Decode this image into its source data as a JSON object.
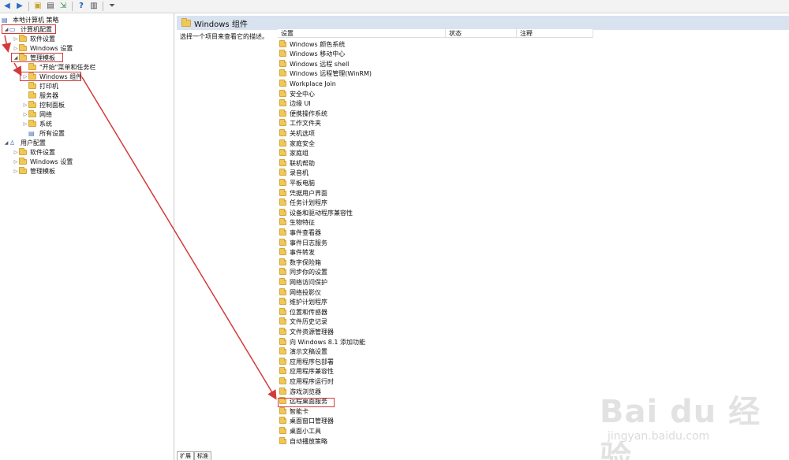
{
  "toolbar": {
    "buttons": [
      {
        "name": "back-icon",
        "glyph": "◀"
      },
      {
        "name": "forward-icon",
        "glyph": "▶"
      },
      {
        "name": "folder-up-icon",
        "glyph": "▣"
      },
      {
        "name": "properties-icon",
        "glyph": "▤"
      },
      {
        "name": "export-icon",
        "glyph": "⇲"
      },
      {
        "name": "help-icon",
        "glyph": "?"
      },
      {
        "name": "show-hide-icon",
        "glyph": "▥"
      },
      {
        "name": "filter-icon",
        "glyph": "⏷"
      }
    ]
  },
  "tree": {
    "root": "本地计算机 策略",
    "computer_config": "计算机配置",
    "software_settings": "软件设置",
    "windows_settings": "Windows 设置",
    "admin_templates": "管理模板",
    "start_menu": "\"开始\"菜单和任务栏",
    "windows_components": "Windows 组件",
    "printers": "打印机",
    "server": "服务器",
    "control_panel": "控制面板",
    "network": "网络",
    "system": "系统",
    "all_settings": "所有设置",
    "user_config": "用户配置",
    "user_software_settings": "软件设置",
    "user_windows_settings": "Windows 设置",
    "user_admin_templates": "管理模板"
  },
  "right": {
    "title": "Windows 组件",
    "description": "选择一个项目来查看它的描述。",
    "columns": [
      "设置",
      "状态",
      "注释"
    ],
    "items": [
      "Windows 颜色系统",
      "Windows 移动中心",
      "Windows 远程 shell",
      "Windows 远程管理(WinRM)",
      "Workplace Join",
      "安全中心",
      "边缘 UI",
      "便携操作系统",
      "工作文件夹",
      "关机选项",
      "家庭安全",
      "家庭组",
      "联机帮助",
      "录音机",
      "平板电脑",
      "凭据用户界面",
      "任务计划程序",
      "设备和驱动程序兼容性",
      "生物特征",
      "事件查看器",
      "事件日志服务",
      "事件转发",
      "数字保险箱",
      "同步你的设置",
      "网络访问保护",
      "网络投影仪",
      "维护计划程序",
      "位置和传感器",
      "文件历史记录",
      "文件资源管理器",
      "向 Windows 8.1 添加功能",
      "演示文稿设置",
      "应用程序包部署",
      "应用程序兼容性",
      "应用程序运行时",
      "游戏浏览器",
      "远程桌面服务",
      "智能卡",
      "桌面窗口管理器",
      "桌面小工具",
      "自动播放策略"
    ]
  },
  "tabs": [
    "扩展",
    "标准"
  ],
  "watermark": {
    "brand": "Bai du 经验",
    "url": "jingyan.baidu.com"
  },
  "colors": {
    "highlight": "#d33a3a",
    "title_bar": "#d9e3f0",
    "folder": "#f0c85a"
  }
}
